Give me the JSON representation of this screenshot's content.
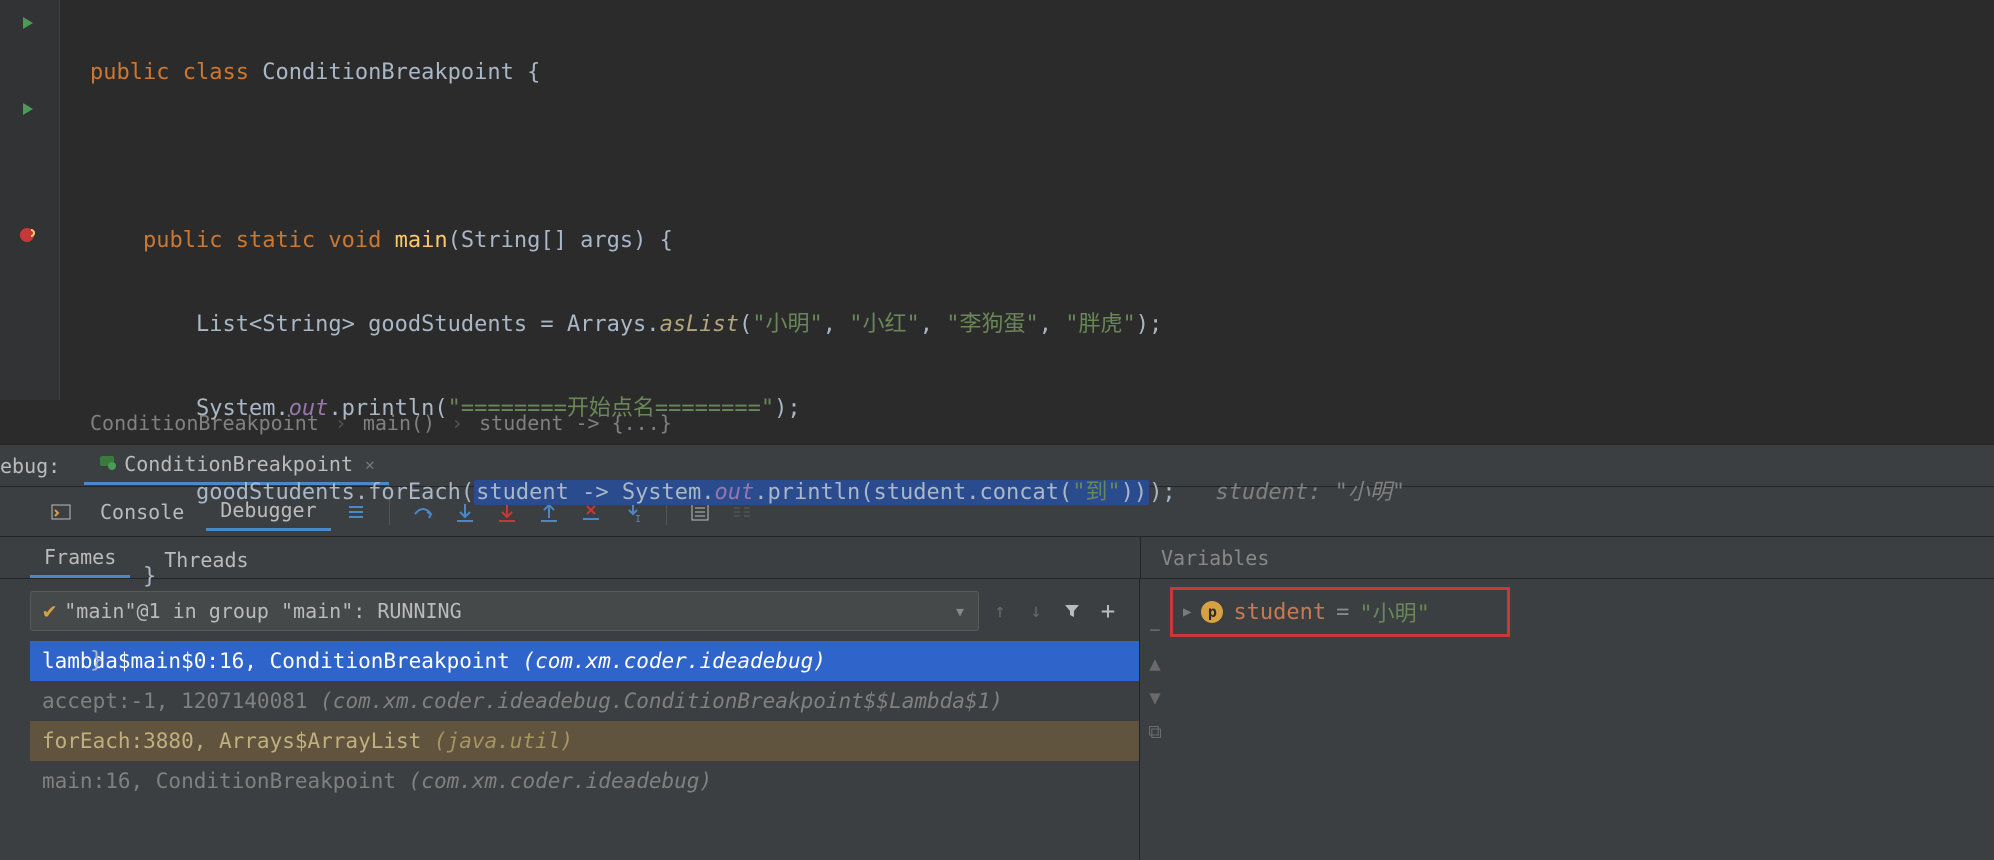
{
  "code": {
    "line1": {
      "kw1": "public ",
      "kw2": "class ",
      "name": "ConditionBreakpoint ",
      "brace": "{"
    },
    "line3": {
      "indent": "    ",
      "kw1": "public ",
      "kw2": "static ",
      "kw3": "void ",
      "method": "main",
      "params": "(String[] args) {"
    },
    "line4": {
      "indent": "        ",
      "lhs": "List<String> goodStudents = Arrays.",
      "call": "asList",
      "args_open": "(",
      "s1": "\"小明\"",
      "c1": ", ",
      "s2": "\"小红\"",
      "c2": ", ",
      "s3": "\"李狗蛋\"",
      "c3": ", ",
      "s4": "\"胖虎\"",
      "close": ");"
    },
    "line5": {
      "indent": "        ",
      "sys": "System.",
      "out": "out",
      "print": ".println(",
      "str": "\"========开始点名========\"",
      "close": ");"
    },
    "line6": {
      "indent": "        ",
      "pre": "goodStudents.forEach(",
      "hl_pre": "student -> System.",
      "hl_out": "out",
      "hl_p1": ".println(student.concat(",
      "hl_str": "\"到\"",
      "hl_p2": "))",
      "post": ");   ",
      "hint": "student: \"小明\""
    },
    "line7": "    }",
    "line8": "}"
  },
  "breadcrumbs": {
    "b1": "ConditionBreakpoint",
    "sep": "›",
    "b2": "main()",
    "b3": "student -> {...}"
  },
  "debug": {
    "label": "ebug:",
    "tab": "ConditionBreakpoint",
    "console": "Console",
    "debugger": "Debugger"
  },
  "frames": {
    "tab_frames": "Frames",
    "tab_threads": "Threads"
  },
  "thread": {
    "text": "\"main\"@1 in group \"main\": RUNNING"
  },
  "stack": [
    {
      "kind": "selected",
      "method": "lambda$main$0:16, ConditionBreakpoint ",
      "pkg": "(com.xm.coder.ideadebug)"
    },
    {
      "kind": "gray",
      "method": "accept:-1, 1207140081 ",
      "pkg": "(com.xm.coder.ideadebug.ConditionBreakpoint$$Lambda$1)"
    },
    {
      "kind": "lib",
      "method": "forEach:3880, Arrays$ArrayList ",
      "pkg": "(java.util)"
    },
    {
      "kind": "normal",
      "method": "main:16, ConditionBreakpoint ",
      "pkg": "(com.xm.coder.ideadebug)"
    }
  ],
  "variables": {
    "title": "Variables",
    "var_name": "student",
    "var_eq": " = ",
    "var_val": "\"小明\""
  }
}
